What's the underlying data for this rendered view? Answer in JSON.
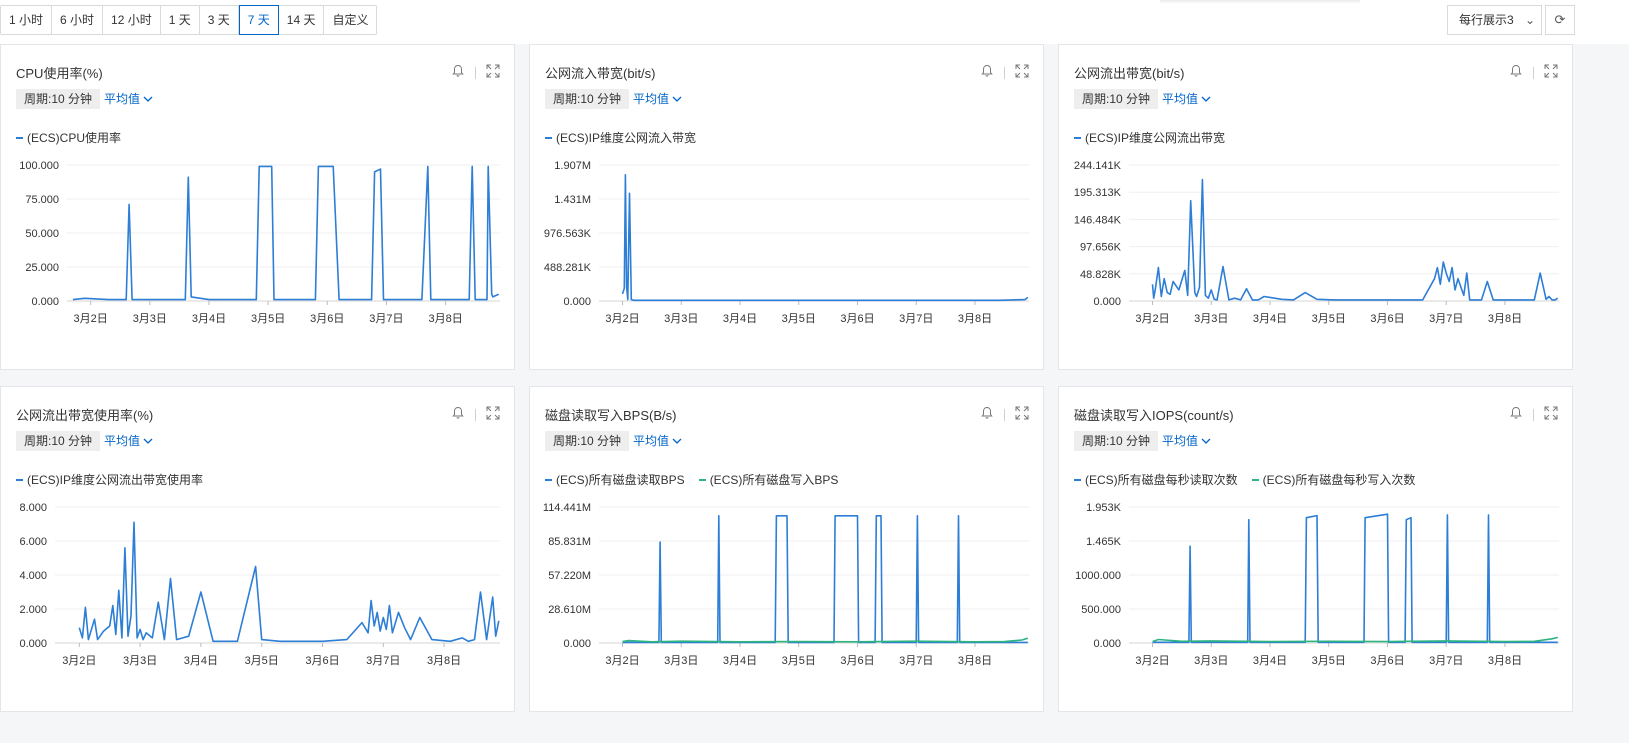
{
  "time_ranges": [
    {
      "label": "1 小时",
      "active": false
    },
    {
      "label": "6 小时",
      "active": false
    },
    {
      "label": "12 小时",
      "active": false
    },
    {
      "label": "1 天",
      "active": false
    },
    {
      "label": "3 天",
      "active": false
    },
    {
      "label": "7 天",
      "active": true
    },
    {
      "label": "14 天",
      "active": false
    },
    {
      "label": "自定义",
      "active": false
    }
  ],
  "per_row_select": {
    "label": "每行展示3"
  },
  "colors": {
    "accent": "#0064c8",
    "series_blue": "#2d7ed6",
    "series_green": "#2eb57e",
    "grid": "#ececec"
  },
  "shared": {
    "period_label": "周期:10 分钟",
    "agg_label": "平均值",
    "x_ticks": [
      "3月2日",
      "3月3日",
      "3月4日",
      "3月5日",
      "3月6日",
      "3月7日",
      "3月8日"
    ]
  },
  "cards": [
    {
      "title": "CPU使用率(%)",
      "chart_data": {
        "type": "line",
        "x_ticks": [
          "3月2日",
          "3月3日",
          "3月4日",
          "3月5日",
          "3月6日",
          "3月7日",
          "3月8日"
        ],
        "y_ticks": [
          "0.000",
          "25.000",
          "50.000",
          "75.000",
          "100.000"
        ],
        "ylim": [
          0,
          100
        ],
        "series": [
          {
            "name": "(ECS)CPU使用率",
            "color": "#2d7ed6",
            "x": [
              1.7,
              1.9,
              2.3,
              2.6,
              2.65,
              2.7,
              3.0,
              3.6,
              3.65,
              3.7,
              4.0,
              4.3,
              4.8,
              4.85,
              5.0,
              5.06,
              5.1,
              5.5,
              5.8,
              5.85,
              5.9,
              6.0,
              6.1,
              6.2,
              6.3,
              6.5,
              6.75,
              6.8,
              6.9,
              6.95,
              7.3,
              7.6,
              7.7,
              7.75,
              8.0,
              8.4,
              8.45,
              8.5,
              8.7,
              8.72,
              8.78,
              8.8,
              8.9
            ],
            "y": [
              1,
              2,
              1,
              1,
              71,
              1,
              1,
              1,
              91,
              3,
              1,
              1,
              1,
              99,
              99,
              99,
              1,
              1,
              1,
              99,
              99,
              99,
              99,
              1,
              1,
              1,
              1,
              95,
              97,
              1,
              1,
              1,
              99,
              1,
              1,
              1,
              99,
              1,
              1,
              99,
              5,
              3,
              5
            ]
          }
        ]
      }
    },
    {
      "title": "公网流入带宽(bit/s)",
      "chart_data": {
        "type": "line",
        "x_ticks": [
          "3月2日",
          "3月3日",
          "3月4日",
          "3月5日",
          "3月6日",
          "3月7日",
          "3月8日"
        ],
        "y_ticks": [
          "0.000",
          "488.281K",
          "976.563K",
          "1.431M",
          "1.907M"
        ],
        "ylim": [
          0,
          1.907
        ],
        "series": [
          {
            "name": "(ECS)IP维度公网流入带宽",
            "color": "#2d7ed6",
            "x": [
              2.0,
              2.03,
              2.05,
              2.07,
              2.09,
              2.12,
              2.15,
              2.2,
              2.5,
              3.0,
              4.0,
              5.0,
              6.0,
              7.0,
              8.0,
              8.4,
              8.85,
              8.9
            ],
            "y": [
              0.1,
              0.18,
              1.77,
              0.2,
              0.02,
              1.51,
              0.02,
              0.01,
              0.01,
              0.01,
              0.01,
              0.01,
              0.01,
              0.01,
              0.01,
              0.01,
              0.02,
              0.05
            ]
          }
        ]
      }
    },
    {
      "title": "公网流出带宽(bit/s)",
      "chart_data": {
        "type": "line",
        "x_ticks": [
          "3月2日",
          "3月3日",
          "3月4日",
          "3月5日",
          "3月6日",
          "3月7日",
          "3月8日"
        ],
        "y_ticks": [
          "0.000",
          "48.828K",
          "97.656K",
          "146.484K",
          "195.313K",
          "244.141K"
        ],
        "ylim": [
          0,
          244.141
        ],
        "series": [
          {
            "name": "(ECS)IP维度公网流出带宽",
            "color": "#2d7ed6",
            "x": [
              2.0,
              2.02,
              2.05,
              2.1,
              2.15,
              2.2,
              2.25,
              2.3,
              2.35,
              2.45,
              2.55,
              2.6,
              2.65,
              2.72,
              2.75,
              2.8,
              2.85,
              2.9,
              2.95,
              3.0,
              3.05,
              3.1,
              3.2,
              3.3,
              3.4,
              3.5,
              3.6,
              3.7,
              3.8,
              3.9,
              4.2,
              4.4,
              4.6,
              4.8,
              5.1,
              5.5,
              6.0,
              6.3,
              6.6,
              6.8,
              6.85,
              6.9,
              6.95,
              7.0,
              7.05,
              7.1,
              7.15,
              7.2,
              7.25,
              7.3,
              7.35,
              7.4,
              7.5,
              7.6,
              7.7,
              7.8,
              8.0,
              8.3,
              8.5,
              8.6,
              8.7,
              8.75,
              8.8,
              8.85,
              8.9
            ],
            "y": [
              30,
              5,
              22,
              60,
              8,
              40,
              15,
              12,
              35,
              20,
              55,
              10,
              180,
              15,
              8,
              25,
              218,
              10,
              5,
              20,
              3,
              2,
              62,
              2,
              5,
              2,
              22,
              2,
              2,
              8,
              3,
              2,
              15,
              3,
              2,
              2,
              2,
              2,
              2,
              40,
              60,
              30,
              70,
              50,
              35,
              60,
              20,
              40,
              25,
              10,
              50,
              2,
              2,
              2,
              35,
              2,
              2,
              2,
              2,
              50,
              3,
              8,
              2,
              2,
              5
            ]
          }
        ]
      }
    },
    {
      "title": "公网流出带宽使用率(%)",
      "chart_data": {
        "type": "line",
        "x_ticks": [
          "3月2日",
          "3月3日",
          "3月4日",
          "3月5日",
          "3月6日",
          "3月7日",
          "3月8日"
        ],
        "y_ticks": [
          "0.000",
          "2.000",
          "4.000",
          "6.000",
          "8.000"
        ],
        "ylim": [
          0,
          8
        ],
        "series": [
          {
            "name": "(ECS)IP维度公网流出带宽使用率",
            "color": "#2d7ed6",
            "x": [
              2.0,
              2.05,
              2.1,
              2.15,
              2.25,
              2.3,
              2.4,
              2.5,
              2.55,
              2.6,
              2.65,
              2.7,
              2.75,
              2.8,
              2.85,
              2.9,
              2.95,
              3.0,
              3.05,
              3.1,
              3.2,
              3.3,
              3.4,
              3.5,
              3.6,
              3.8,
              4.0,
              4.2,
              4.6,
              4.9,
              5.0,
              5.3,
              6.0,
              6.4,
              6.65,
              6.75,
              6.8,
              6.85,
              6.9,
              6.95,
              7.0,
              7.05,
              7.1,
              7.15,
              7.25,
              7.35,
              7.45,
              7.6,
              7.8,
              8.1,
              8.3,
              8.4,
              8.5,
              8.6,
              8.7,
              8.8,
              8.85,
              8.9
            ],
            "y": [
              0.9,
              0.3,
              2.1,
              0.2,
              1.4,
              0.2,
              0.7,
              1.0,
              2.2,
              0.5,
              3.1,
              0.3,
              5.6,
              0.4,
              1.6,
              7.1,
              0.3,
              0.8,
              0.2,
              0.6,
              0.3,
              2.4,
              0.2,
              3.8,
              0.2,
              0.4,
              3.0,
              0.1,
              0.1,
              4.5,
              0.2,
              0.1,
              0.1,
              0.2,
              1.2,
              0.6,
              2.5,
              1.0,
              1.8,
              0.7,
              1.5,
              0.8,
              2.2,
              0.6,
              1.8,
              0.9,
              0.2,
              1.5,
              0.2,
              0.1,
              0.3,
              0.1,
              0.2,
              3.0,
              0.2,
              2.7,
              0.4,
              1.3
            ]
          }
        ]
      }
    },
    {
      "title": "磁盘读取写入BPS(B/s)",
      "chart_data": {
        "type": "line",
        "x_ticks": [
          "3月2日",
          "3月3日",
          "3月4日",
          "3月5日",
          "3月6日",
          "3月7日",
          "3月8日"
        ],
        "y_ticks": [
          "0.000",
          "28.610M",
          "57.220M",
          "85.831M",
          "114.441M"
        ],
        "ylim": [
          0,
          114.441
        ],
        "series": [
          {
            "name": "(ECS)所有磁盘读取BPS",
            "color": "#2d7ed6",
            "x": [
              2.0,
              2.62,
              2.64,
              2.66,
              3.62,
              3.64,
              3.66,
              4.6,
              4.62,
              4.8,
              4.82,
              5.6,
              5.62,
              6.0,
              6.02,
              6.3,
              6.32,
              6.4,
              6.42,
              7.0,
              7.02,
              7.04,
              7.7,
              7.72,
              7.74,
              8.9
            ],
            "y": [
              0.5,
              0.5,
              85,
              0.5,
              0.5,
              107,
              0.5,
              0.5,
              107,
              107,
              0.5,
              0.5,
              107,
              107,
              0.5,
              0.5,
              107,
              107,
              0.5,
              0.5,
              107,
              0.5,
              0.5,
              107,
              0.5,
              0.5
            ]
          },
          {
            "name": "(ECS)所有磁盘写入BPS",
            "color": "#2eb57e",
            "x": [
              2.0,
              2.1,
              2.5,
              3.0,
              4.0,
              5.0,
              6.0,
              7.0,
              8.0,
              8.5,
              8.8,
              8.9
            ],
            "y": [
              1.2,
              2.0,
              1.0,
              1.5,
              1.0,
              1.2,
              1.0,
              1.5,
              1.0,
              1.2,
              2.5,
              4.0
            ]
          }
        ]
      }
    },
    {
      "title": "磁盘读取写入IOPS(count/s)",
      "chart_data": {
        "type": "line",
        "x_ticks": [
          "3月2日",
          "3月3日",
          "3月4日",
          "3月5日",
          "3月6日",
          "3月7日",
          "3月8日"
        ],
        "y_ticks": [
          "0.000",
          "500.000",
          "1000.000",
          "1.465K",
          "1.953K"
        ],
        "ylim": [
          0,
          1953
        ],
        "series": [
          {
            "name": "(ECS)所有磁盘每秒读取次数",
            "color": "#2d7ed6",
            "x": [
              2.0,
              2.62,
              2.64,
              2.66,
              3.62,
              3.64,
              3.66,
              4.6,
              4.62,
              4.8,
              4.82,
              5.6,
              5.62,
              6.0,
              6.02,
              6.3,
              6.32,
              6.4,
              6.42,
              7.0,
              7.02,
              7.04,
              7.7,
              7.72,
              7.74,
              8.9
            ],
            "y": [
              10,
              10,
              1390,
              10,
              10,
              1770,
              10,
              10,
              1800,
              1830,
              10,
              10,
              1800,
              1850,
              10,
              10,
              1770,
              1800,
              10,
              10,
              1840,
              10,
              10,
              1840,
              10,
              10
            ]
          },
          {
            "name": "(ECS)所有磁盘每秒写入次数",
            "color": "#2eb57e",
            "x": [
              2.0,
              2.1,
              2.5,
              3.0,
              4.0,
              5.0,
              6.0,
              7.0,
              8.0,
              8.5,
              8.8,
              8.9
            ],
            "y": [
              20,
              50,
              25,
              30,
              20,
              25,
              20,
              30,
              20,
              25,
              60,
              80
            ]
          }
        ]
      }
    }
  ]
}
